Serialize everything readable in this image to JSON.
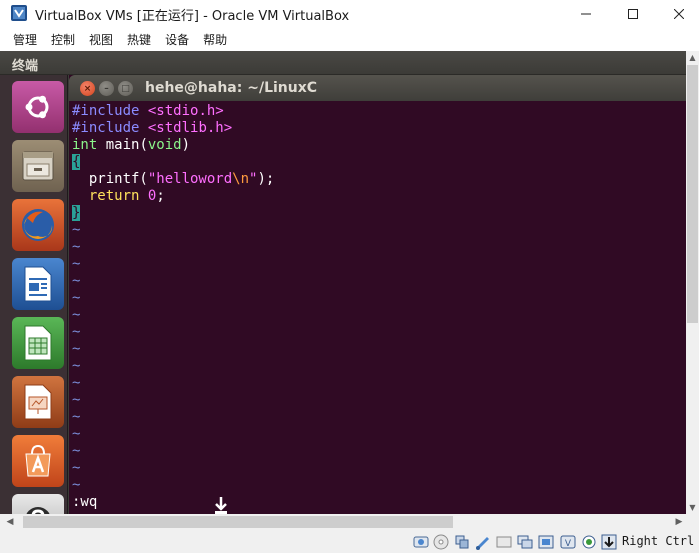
{
  "window": {
    "title": "VirtualBox VMs [正在运行] - Oracle VM VirtualBox",
    "icons": {
      "app": "virtualbox-icon",
      "minimize": "minimize-icon",
      "maximize": "maximize-icon",
      "close": "close-icon"
    }
  },
  "menubar": {
    "items": [
      {
        "label": "管理"
      },
      {
        "label": "控制"
      },
      {
        "label": "视图"
      },
      {
        "label": "热键"
      },
      {
        "label": "设备"
      },
      {
        "label": "帮助"
      }
    ]
  },
  "guest": {
    "panel_title": "终端",
    "launcher": [
      {
        "name": "ubuntu-dash-icon",
        "color": "#b94393"
      },
      {
        "name": "files-icon",
        "color": "#8a7b64"
      },
      {
        "name": "firefox-icon",
        "color": "#e46a21"
      },
      {
        "name": "libreoffice-writer-icon",
        "color": "#2f6ab5"
      },
      {
        "name": "libreoffice-calc-icon",
        "color": "#3d9b3a"
      },
      {
        "name": "libreoffice-impress-icon",
        "color": "#b5562a"
      },
      {
        "name": "software-center-icon",
        "color": "#e0602a"
      },
      {
        "name": "help-icon",
        "color": "#555555"
      }
    ],
    "terminal": {
      "title": "hehe@haha: ~/LinuxC",
      "buttons": {
        "close": "×",
        "minimize": "–",
        "maximize": "□"
      },
      "code": {
        "l1_pre": "#include",
        "l1_inc": "<stdio.h>",
        "l2_pre": "#include",
        "l2_inc": "<stdlib.h>",
        "l3_type": "int",
        "l3_rest": " main(",
        "l3_void": "void",
        "l3_close": ")",
        "l4_brace": "{",
        "l5_a": "  printf(",
        "l5_str1": "\"helloword",
        "l5_esc": "\\n",
        "l5_str2": "\"",
        "l5_b": ");",
        "l6_kw": "  return",
        "l6_sp": " ",
        "l6_num": "0",
        "l6_end": ";",
        "l7_brace": "}"
      },
      "tilde": "~",
      "cmdline": ":wq"
    }
  },
  "statusbar": {
    "icons": [
      "hard-disk-icon",
      "optical-drive-icon",
      "usb-icon",
      "shared-folder-icon",
      "display-icon",
      "network-icon",
      "audio-icon",
      "video-capture-icon",
      "recording-icon",
      "mouse-integration-icon",
      "keyboard-capture-icon"
    ],
    "host_key": "Right Ctrl"
  }
}
